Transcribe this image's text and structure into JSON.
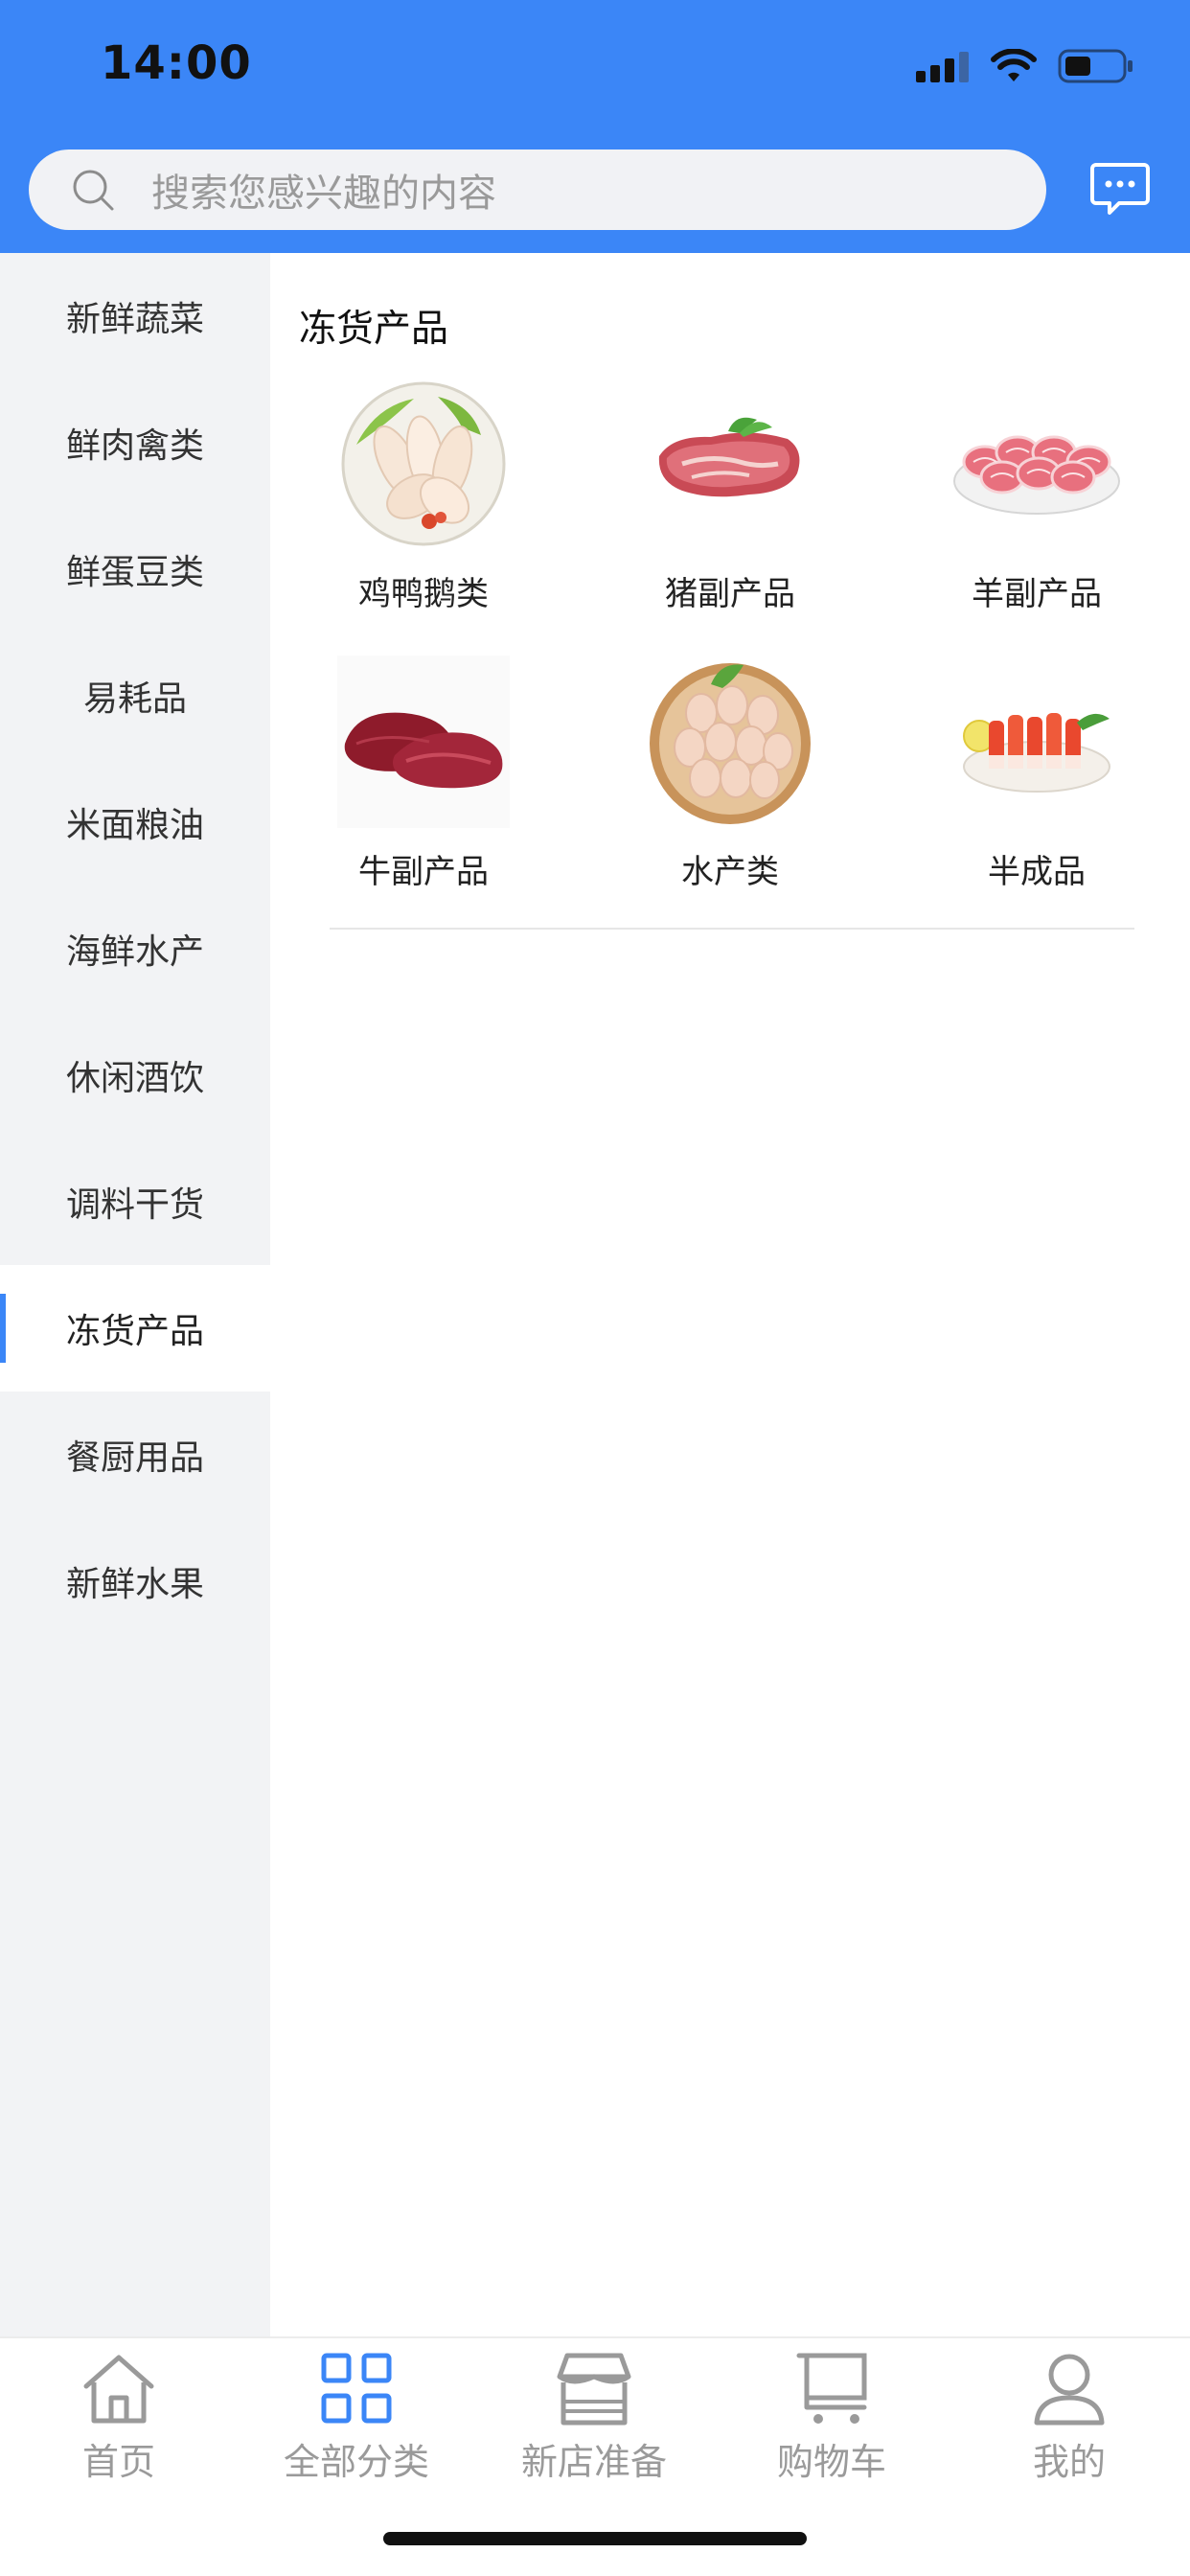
{
  "status_bar": {
    "time": "14:00"
  },
  "search": {
    "placeholder": "搜索您感兴趣的内容"
  },
  "sidebar": {
    "items": [
      {
        "label": "新鲜蔬菜"
      },
      {
        "label": "鲜肉禽类"
      },
      {
        "label": "鲜蛋豆类"
      },
      {
        "label": "易耗品"
      },
      {
        "label": "米面粮油"
      },
      {
        "label": "海鲜水产"
      },
      {
        "label": "休闲酒饮"
      },
      {
        "label": "调料干货"
      },
      {
        "label": "冻货产品",
        "active": true
      },
      {
        "label": "餐厨用品"
      },
      {
        "label": "新鲜水果"
      }
    ]
  },
  "main": {
    "section_title": "冻货产品",
    "products": [
      {
        "label": "鸡鸭鹅类",
        "image": "chicken-wings-image"
      },
      {
        "label": "猪副产品",
        "image": "pork-steak-image"
      },
      {
        "label": "羊副产品",
        "image": "lamb-rolls-image"
      },
      {
        "label": "牛副产品",
        "image": "beef-image"
      },
      {
        "label": "水产类",
        "image": "eggs-basket-image"
      },
      {
        "label": "半成品",
        "image": "crab-sticks-image"
      }
    ]
  },
  "tabbar": {
    "tabs": [
      {
        "label": "首页",
        "icon": "home-icon"
      },
      {
        "label": "全部分类",
        "icon": "grid-icon",
        "active": true
      },
      {
        "label": "新店准备",
        "icon": "store-icon"
      },
      {
        "label": "购物车",
        "icon": "cart-icon"
      },
      {
        "label": "我的",
        "icon": "user-icon"
      }
    ]
  },
  "colors": {
    "accent": "#3b86f7",
    "sidebar_bg": "#f2f3f5",
    "tab_inactive": "#9a9a9a"
  }
}
